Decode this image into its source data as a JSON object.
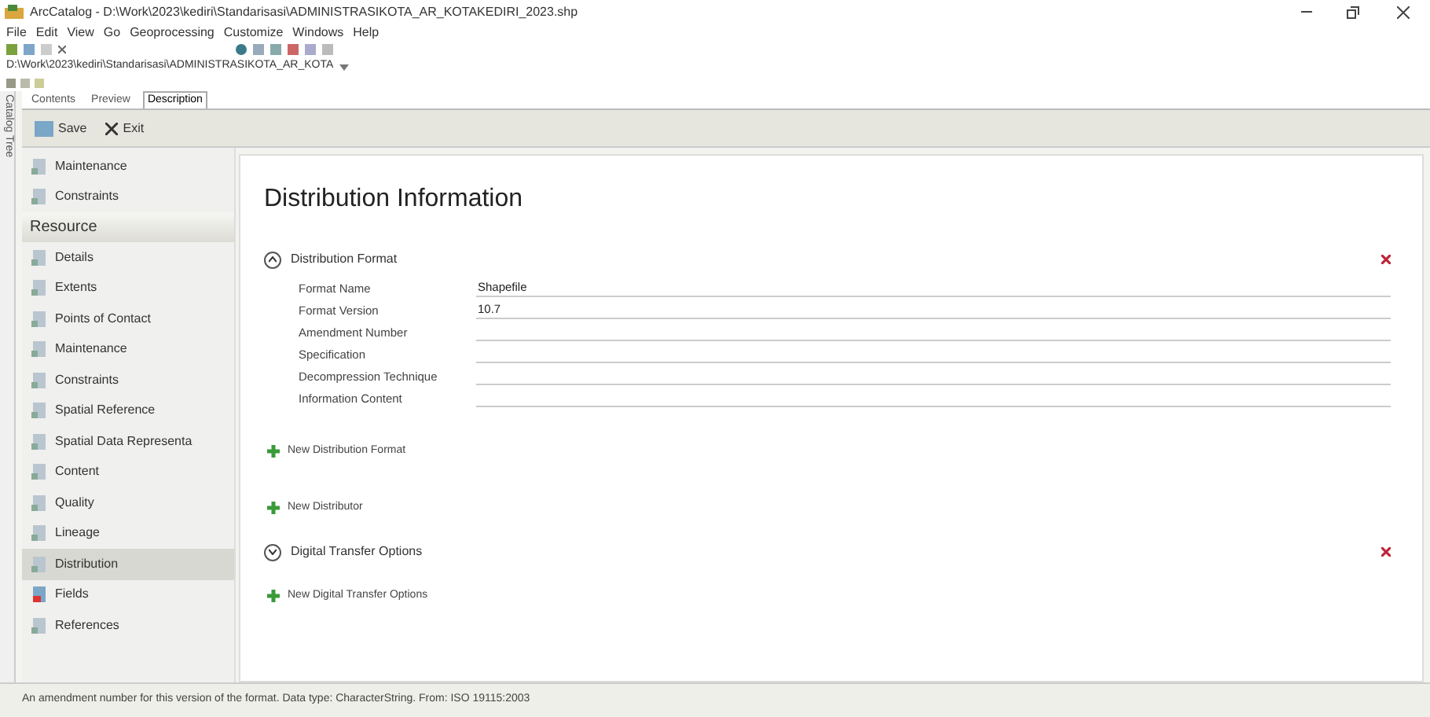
{
  "window": {
    "title": "ArcCatalog - D:\\Work\\2023\\kediri\\Standarisasi\\ADMINISTRASIKOTA_AR_KOTAKEDIRI_2023.shp"
  },
  "menu": [
    "File",
    "Edit",
    "View",
    "Go",
    "Geoprocessing",
    "Customize",
    "Windows",
    "Help"
  ],
  "location": {
    "value": "D:\\Work\\2023\\kediri\\Standarisasi\\ADMINISTRASIKOTA_AR_KOTA"
  },
  "side_tab": "Catalog Tree",
  "tabs": [
    {
      "label": "Contents",
      "selected": false
    },
    {
      "label": "Preview",
      "selected": false
    },
    {
      "label": "Description",
      "selected": true
    }
  ],
  "edit_toolbar": [
    "Save",
    "Exit"
  ],
  "sidebar": {
    "items": [
      {
        "kind": "item",
        "label": "Maintenance",
        "selected": false
      },
      {
        "kind": "item",
        "label": "Constraints",
        "selected": false
      },
      {
        "kind": "header",
        "label": "Resource"
      },
      {
        "kind": "item",
        "label": "Details",
        "selected": false
      },
      {
        "kind": "item",
        "label": "Extents",
        "selected": false
      },
      {
        "kind": "item",
        "label": "Points of Contact",
        "selected": false
      },
      {
        "kind": "item",
        "label": "Maintenance",
        "selected": false
      },
      {
        "kind": "item",
        "label": "Constraints",
        "selected": false
      },
      {
        "kind": "item",
        "label": "Spatial Reference",
        "selected": false
      },
      {
        "kind": "item",
        "label": "Spatial Data Representa",
        "selected": false
      },
      {
        "kind": "item",
        "label": "Content",
        "selected": false
      },
      {
        "kind": "item",
        "label": "Quality",
        "selected": false
      },
      {
        "kind": "item",
        "label": "Lineage",
        "selected": false
      },
      {
        "kind": "item",
        "label": "Distribution",
        "selected": true
      },
      {
        "kind": "fields",
        "label": "Fields",
        "selected": false
      },
      {
        "kind": "item",
        "label": "References",
        "selected": false
      }
    ]
  },
  "content": {
    "title": "Distribution Information",
    "blocks": [
      {
        "kind": "section",
        "label": "Distribution Format",
        "expanded": true,
        "fields": [
          {
            "label": "Format Name",
            "value": "Shapefile"
          },
          {
            "label": "Format Version",
            "value": "10.7"
          },
          {
            "label": "Amendment Number"
          },
          {
            "label": "Specification"
          },
          {
            "label": "Decompression Technique"
          },
          {
            "label": "Information Content"
          }
        ]
      },
      {
        "kind": "add",
        "label": "New Distribution Format"
      },
      {
        "kind": "add",
        "label": "New Distributor"
      },
      {
        "kind": "section",
        "label": "Digital Transfer Options",
        "expanded": false
      },
      {
        "kind": "add",
        "label": "New Digital Transfer Options"
      }
    ]
  },
  "status_bar": "An amendment number for this version of the format. Data type: CharacterString. From: ISO 19115:2003"
}
